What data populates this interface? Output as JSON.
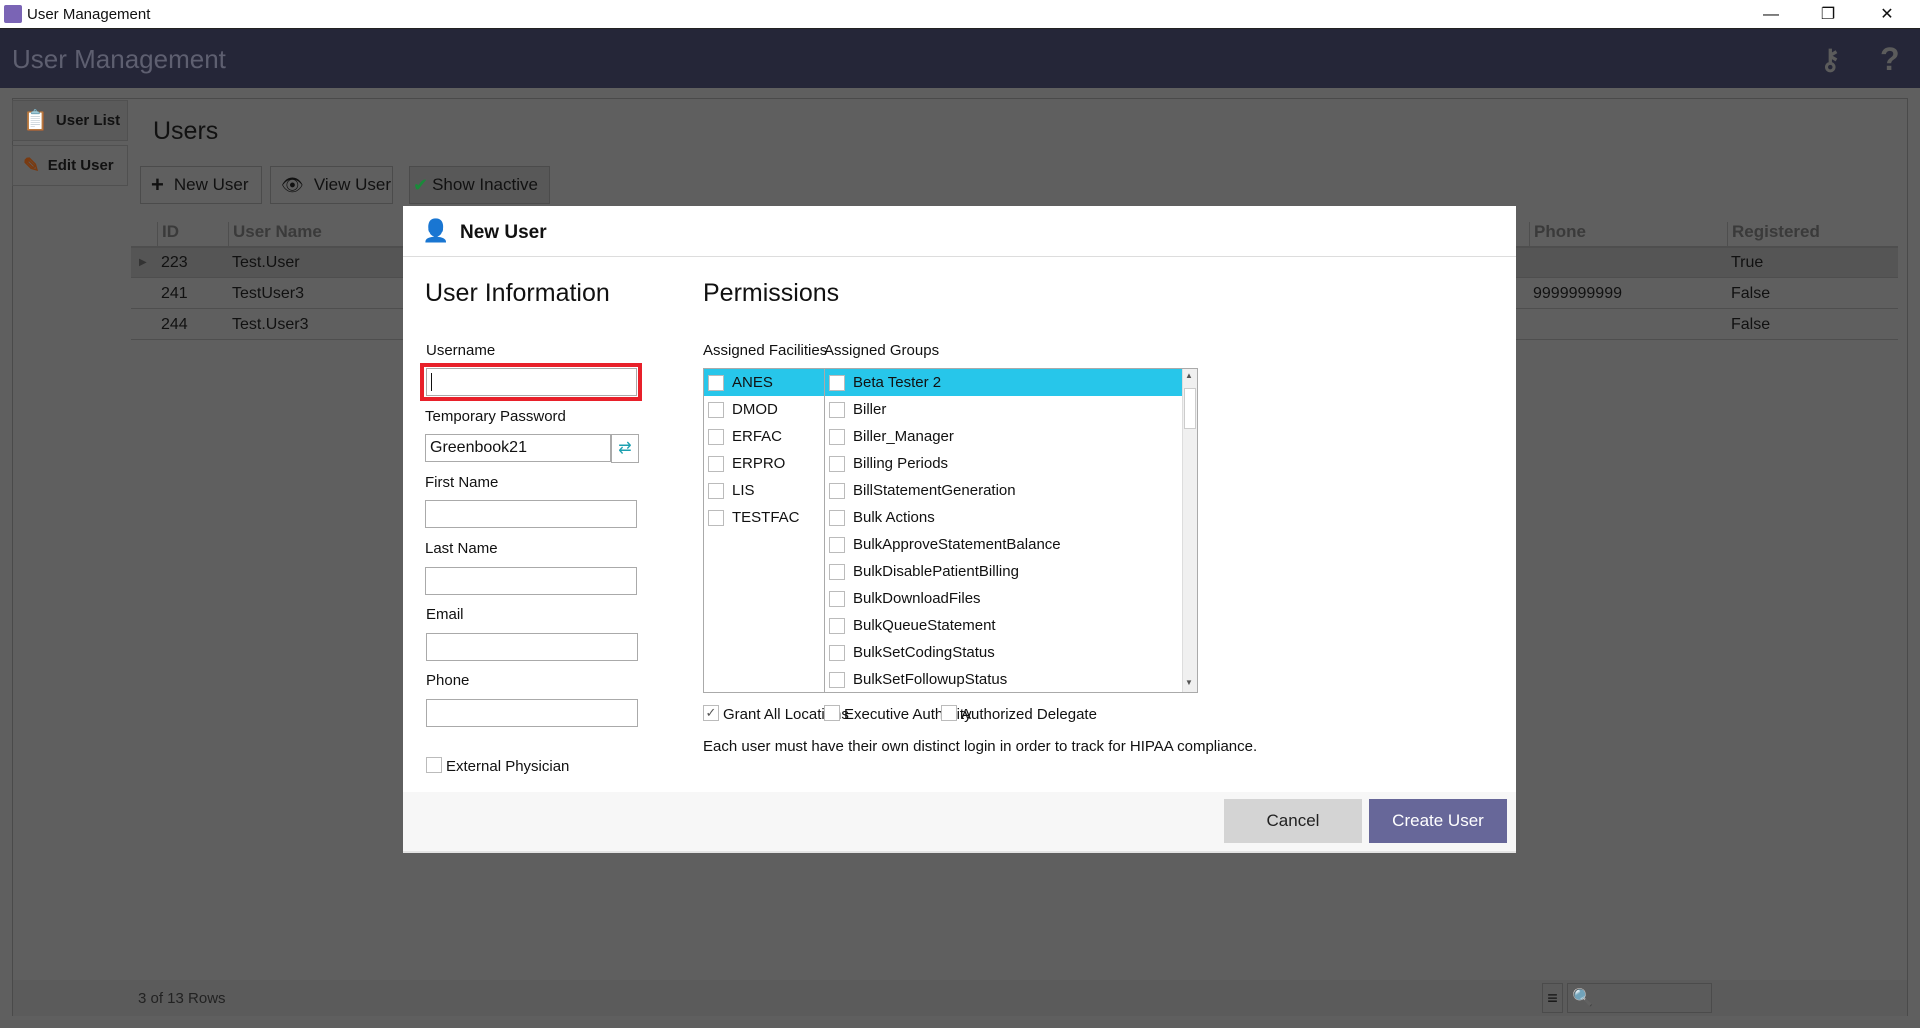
{
  "window": {
    "title": "User Management",
    "minimize": "—",
    "restore": "❐",
    "close": "✕"
  },
  "header": {
    "title": "User Management",
    "keys_icon": "keys-icon",
    "help": "?"
  },
  "sidebar": {
    "items": [
      {
        "label": "User List",
        "icon": "clipboard-icon"
      },
      {
        "label": "Edit User",
        "icon": "pencil-icon"
      }
    ]
  },
  "main": {
    "title": "Users",
    "toolbar": {
      "new_user": "New User",
      "view_user": "View User",
      "show_inactive": "Show Inactive"
    },
    "grid": {
      "columns": [
        "ID",
        "User Name",
        "Phone",
        "Registered"
      ],
      "rows": [
        [
          "223",
          "Test.User",
          "",
          "True"
        ],
        [
          "241",
          "TestUser3",
          "9999999999",
          "False"
        ],
        [
          "244",
          "Test.User3",
          "",
          "False"
        ]
      ]
    },
    "footer": {
      "rows_count": "3 of 13 Rows",
      "search_placeholder": ""
    }
  },
  "dialog": {
    "title": "New User",
    "user_info": {
      "heading": "User Information",
      "username_label": "Username",
      "username_value": "",
      "temp_password_label": "Temporary Password",
      "temp_password_value": "Greenbook21",
      "first_name_label": "First Name",
      "first_name_value": "",
      "last_name_label": "Last Name",
      "last_name_value": "",
      "email_label": "Email",
      "email_value": "",
      "phone_label": "Phone",
      "phone_value": "",
      "external_physician_label": "External Physician",
      "external_physician_checked": false
    },
    "permissions": {
      "heading": "Permissions",
      "facilities_label": "Assigned Facilities",
      "facilities": [
        "ANES",
        "DMOD",
        "ERFAC",
        "ERPRO",
        "LIS",
        "TESTFAC"
      ],
      "groups_label": "Assigned Groups",
      "groups": [
        "Beta Tester 2",
        "Biller",
        "Biller_Manager",
        "Billing Periods",
        "BillStatementGeneration",
        "Bulk Actions",
        "BulkApproveStatementBalance",
        "BulkDisablePatientBilling",
        "BulkDownloadFiles",
        "BulkQueueStatement",
        "BulkSetCodingStatus",
        "BulkSetFollowupStatus"
      ],
      "grant_all_locations": "Grant All Locations",
      "grant_all_locations_checked": true,
      "executive_authority": "Executive Authority",
      "authorized_delegate": "Authorized Delegate",
      "note": "Each user must have their own distinct login in order to track for HIPAA compliance."
    },
    "cancel": "Cancel",
    "create": "Create User"
  },
  "colors": {
    "highlight": "#27c6ea",
    "focus_border": "#e8202a",
    "primary_button": "#676799",
    "header": "#252638"
  }
}
